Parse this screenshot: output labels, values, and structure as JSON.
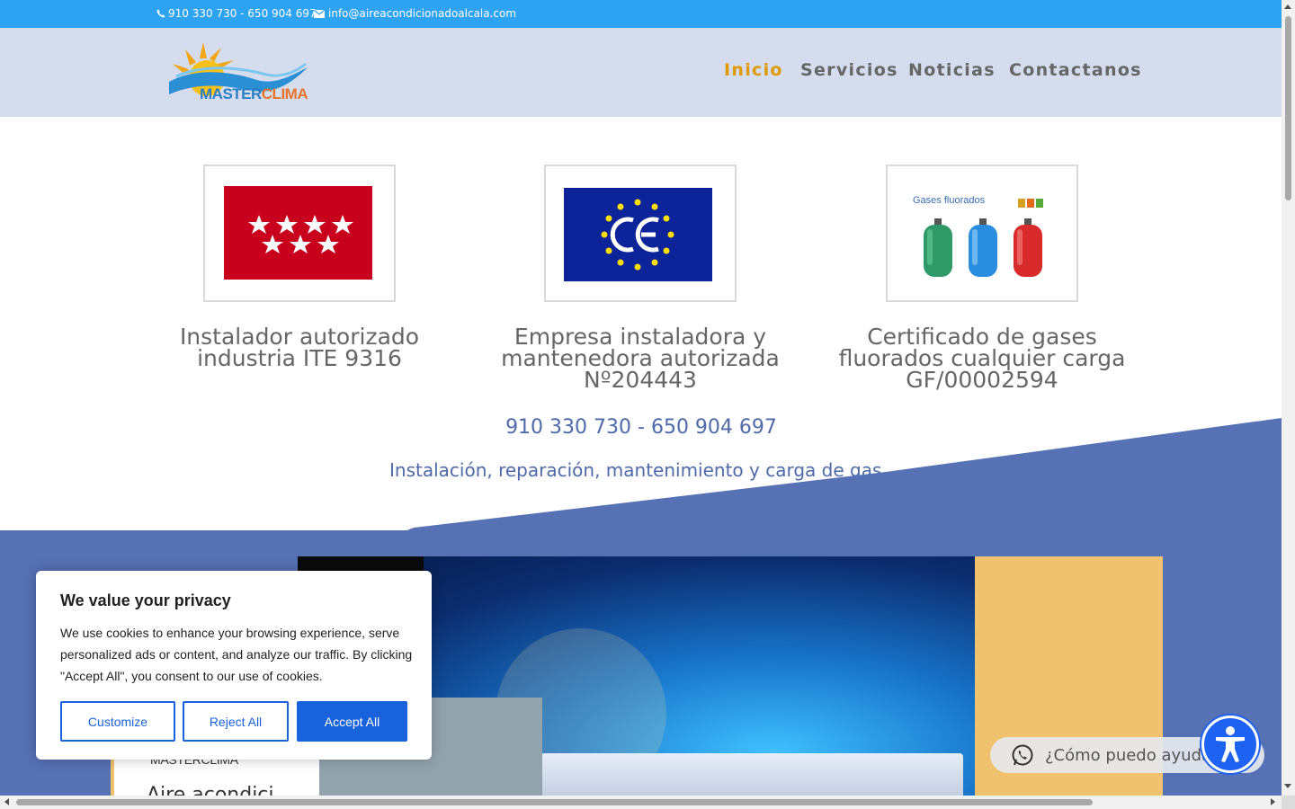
{
  "topbar": {
    "phone": "910 330 730 - 650 904 697",
    "email": "info@aireacondicionadoalcala.com"
  },
  "logo": {
    "word1": "MASTER",
    "word2": "CLIMA"
  },
  "nav": {
    "items": [
      {
        "label": "Inicio",
        "active": true
      },
      {
        "label": "Servicios",
        "active": false
      },
      {
        "label": "Noticias",
        "active": false
      },
      {
        "label": "Contactanos",
        "active": false
      }
    ]
  },
  "cards": [
    {
      "line1": "Instalador autorizado",
      "line2": "industria ITE 9316",
      "line3": ""
    },
    {
      "line1": "Empresa instaladora y",
      "line2": "mantenedora autorizada",
      "line3": "Nº204443"
    },
    {
      "line1": "Certificado de gases",
      "line2": "fluorados cualquier carga",
      "line3": "GF/00002594"
    }
  ],
  "gases_label": "Gases fluorados",
  "phones": "910 330 730 - 650 904 697",
  "tagline": "Instalación, reparación, mantenimiento y carga de gas",
  "promo": {
    "brand": "MASTERCLIMA",
    "heading_partial": "Aire acondici"
  },
  "cookie": {
    "title": "We value your privacy",
    "body": "We use cookies to enhance your browsing experience, serve personalized ads or content, and analyze our traffic. By clicking \"Accept All\", you consent to our use of cookies.",
    "customize": "Customize",
    "reject": "Reject All",
    "accept": "Accept All"
  },
  "whatsapp": {
    "label": "¿Cómo puedo ayudarte?"
  },
  "colors": {
    "topbar": "#2ea3f2",
    "nav_active": "#e09900",
    "band": "#5671b4",
    "cookie_button": "#1863dc",
    "accessibility": "#1d62f0"
  }
}
